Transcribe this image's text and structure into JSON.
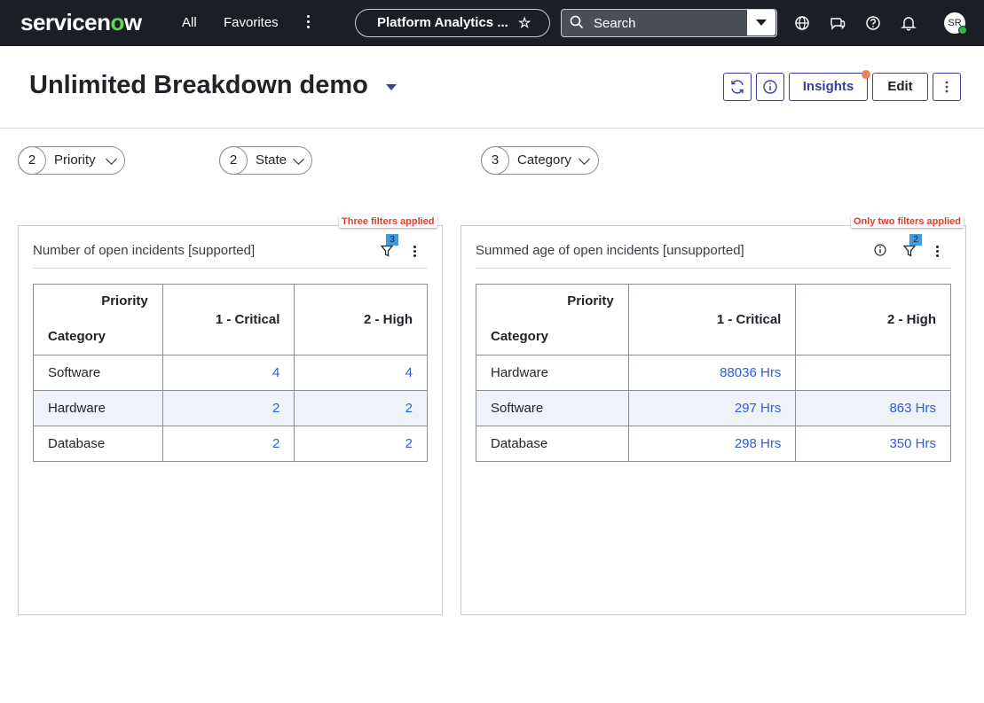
{
  "nav": {
    "logo_pre": "servicen",
    "logo_o": "o",
    "logo_post": "w",
    "all": "All",
    "favorites": "Favorites",
    "app_pill": "Platform Analytics ...",
    "search_label": "Search",
    "avatar": "SR"
  },
  "header": {
    "title": "Unlimited Breakdown demo",
    "insights": "Insights",
    "edit": "Edit"
  },
  "filters": [
    {
      "count": "2",
      "label": "Priority"
    },
    {
      "count": "2",
      "label": "State"
    },
    {
      "count": "3",
      "label": "Category"
    }
  ],
  "cards": [
    {
      "title": "Number of open incidents [supported]",
      "annotation": "Three filters applied",
      "filter_count": "3",
      "corner_top": "Priority",
      "corner_bottom": "Category",
      "columns": [
        "1 - Critical",
        "2 - High"
      ],
      "rows": [
        {
          "label": "Software",
          "values": [
            "4",
            "4"
          ]
        },
        {
          "label": "Hardware",
          "values": [
            "2",
            "2"
          ]
        },
        {
          "label": "Database",
          "values": [
            "2",
            "2"
          ]
        }
      ]
    },
    {
      "title": "Summed age of open incidents [unsupported]",
      "annotation": "Only two filters applied",
      "filter_count": "2",
      "corner_top": "Priority",
      "corner_bottom": "Category",
      "columns": [
        "1 - Critical",
        "2 - High"
      ],
      "rows": [
        {
          "label": "Hardware",
          "values": [
            "88036 Hrs",
            ""
          ]
        },
        {
          "label": "Software",
          "values": [
            "297 Hrs",
            "863 Hrs"
          ]
        },
        {
          "label": "Database",
          "values": [
            "298 Hrs",
            "350 Hrs"
          ]
        }
      ]
    }
  ],
  "colors": {
    "nav_bg": "#1b1e24",
    "accent": "#3b3f9c",
    "link": "#2f5fd0",
    "brand_green": "#62d84e",
    "annotation": "#e23c2e",
    "filter_badge": "#3f9ae0"
  }
}
